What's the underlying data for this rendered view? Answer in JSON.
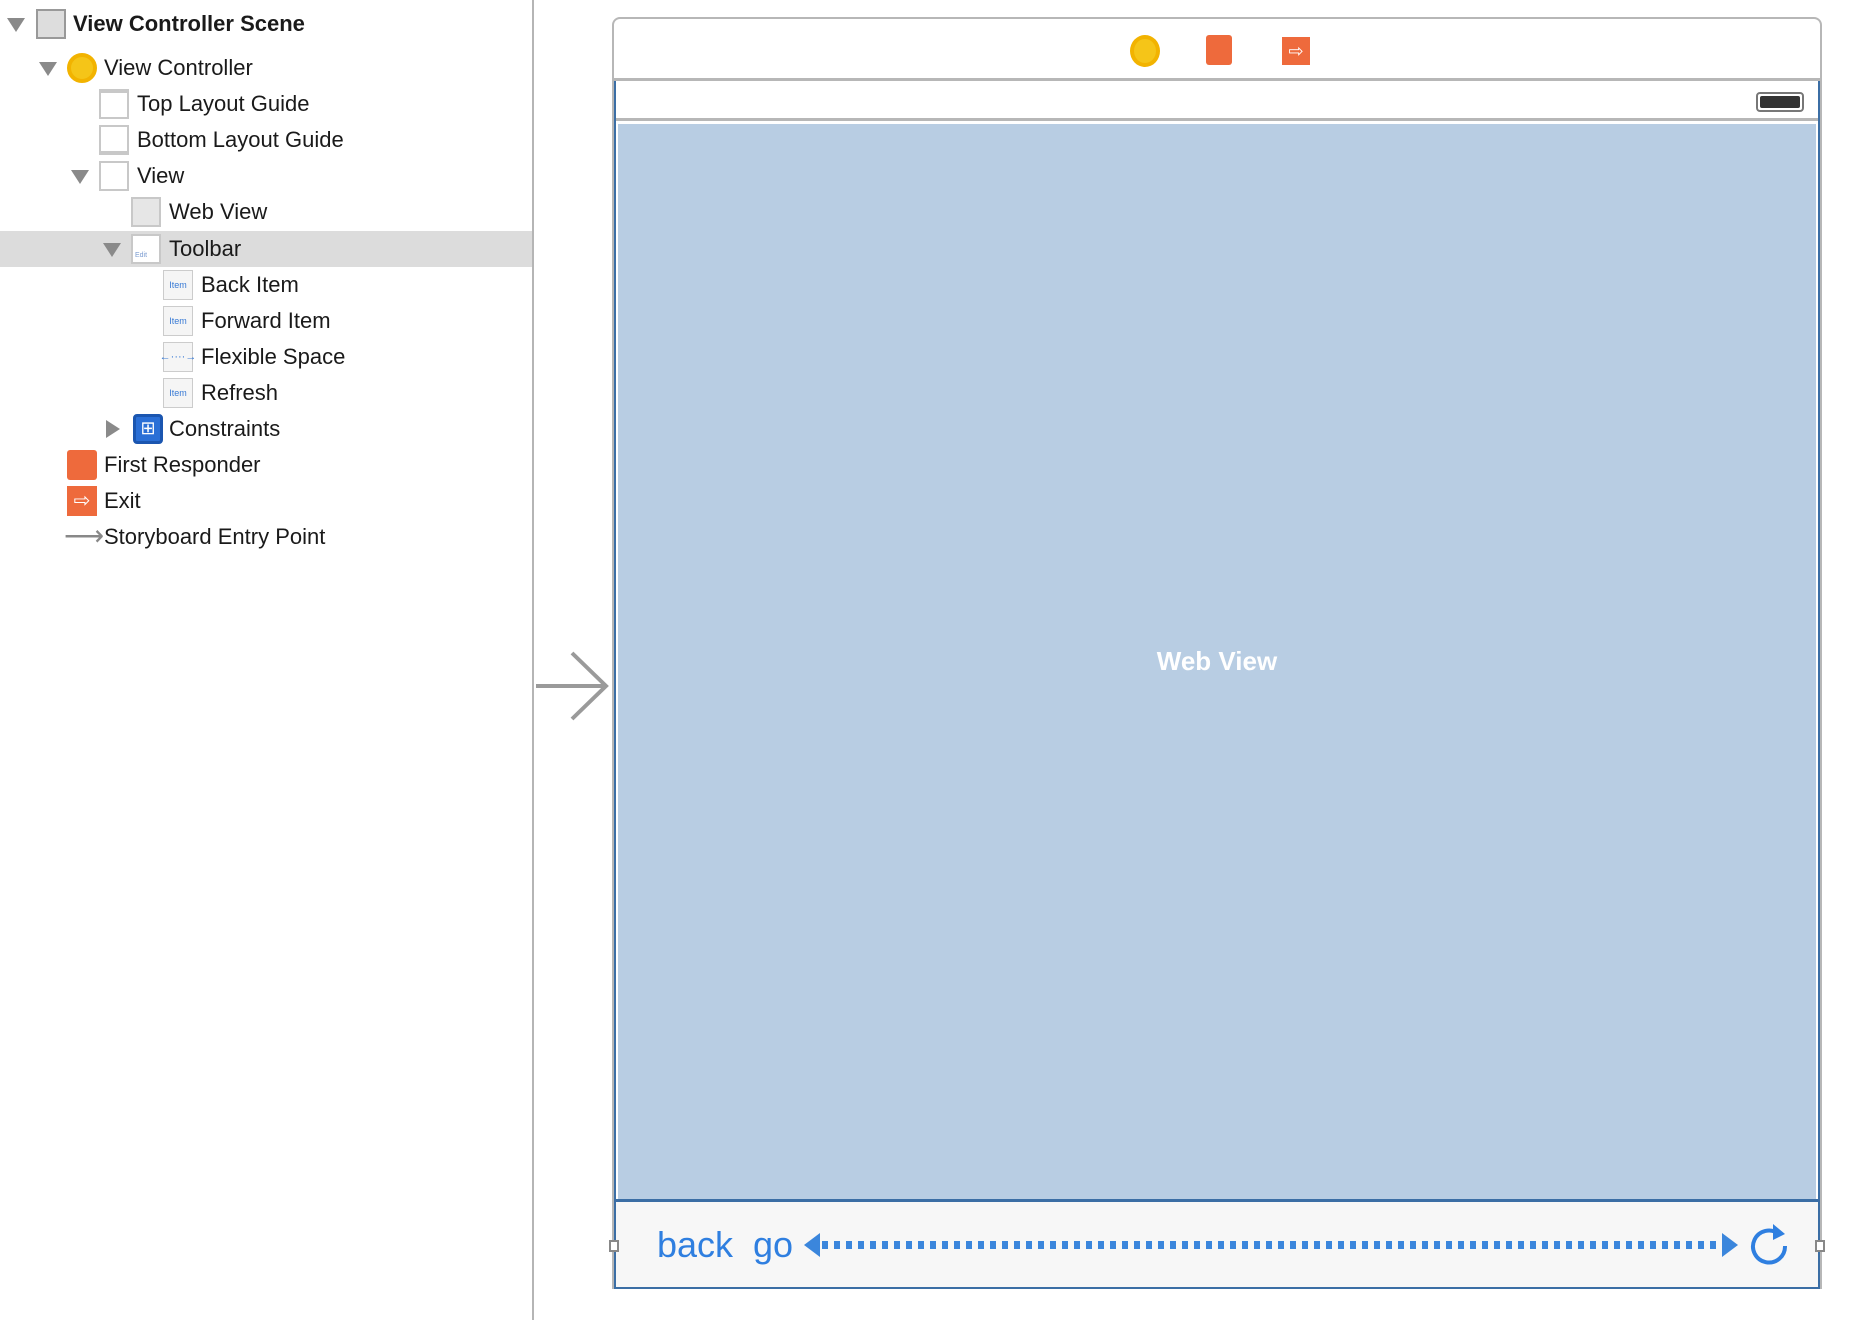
{
  "outline": {
    "items": [
      {
        "label": "View Controller Scene",
        "icon": "scene-icon",
        "expanded": true
      },
      {
        "label": "View Controller",
        "icon": "view-controller-icon",
        "expanded": true
      },
      {
        "label": "Top Layout Guide",
        "icon": "top-layout-guide-icon"
      },
      {
        "label": "Bottom Layout Guide",
        "icon": "bottom-layout-guide-icon"
      },
      {
        "label": "View",
        "icon": "view-icon",
        "expanded": true
      },
      {
        "label": "Web View",
        "icon": "web-view-icon"
      },
      {
        "label": "Toolbar",
        "icon": "toolbar-icon",
        "expanded": true,
        "selected": true
      },
      {
        "label": "Back Item",
        "icon": "bar-item-icon"
      },
      {
        "label": "Forward Item",
        "icon": "bar-item-icon"
      },
      {
        "label": "Flexible Space",
        "icon": "flexible-space-icon"
      },
      {
        "label": "Refresh",
        "icon": "bar-item-icon"
      },
      {
        "label": "Constraints",
        "icon": "constraints-icon",
        "expanded": false
      },
      {
        "label": "First Responder",
        "icon": "first-responder-icon"
      },
      {
        "label": "Exit",
        "icon": "exit-icon"
      },
      {
        "label": "Storyboard Entry Point",
        "icon": "entry-arrow-icon"
      }
    ],
    "item_icon_text": "Item",
    "toolbar_icon_text": "Edit"
  },
  "canvas": {
    "web_view_label": "Web View",
    "toolbar": {
      "back": "back",
      "go": "go"
    },
    "colors": {
      "web_view": "#b8cde3",
      "tint": "#2f7fe0",
      "selection": "#dcdcdc",
      "accent_orange": "#ee6a3c",
      "accent_yellow": "#f5c518"
    }
  }
}
